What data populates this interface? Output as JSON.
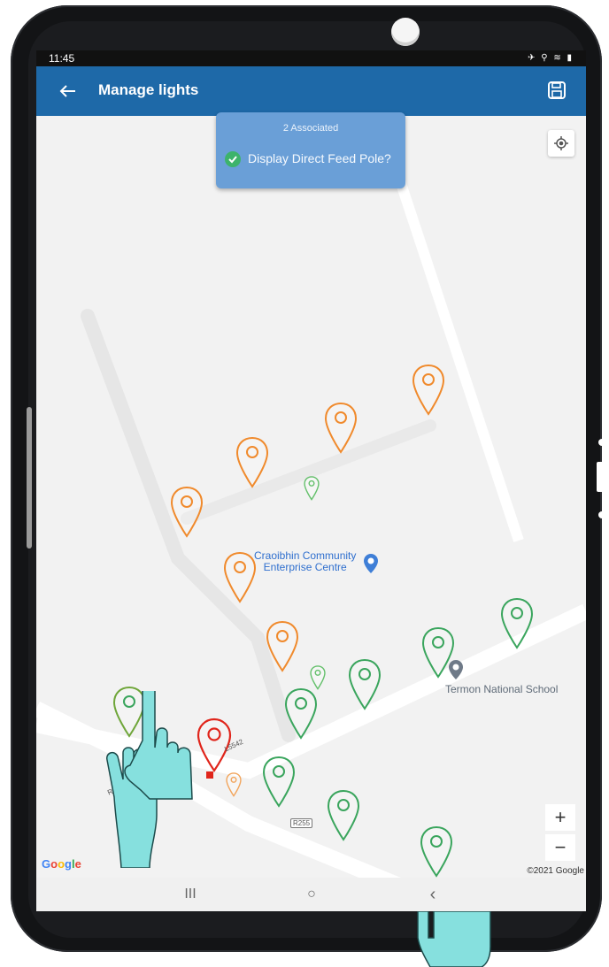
{
  "status_bar": {
    "time": "11:45",
    "icons": "✈ ⚲ ≋ ▮"
  },
  "app_bar": {
    "title": "Manage lights",
    "back_icon": "arrow-left-icon",
    "save_icon": "floppy-disk-icon"
  },
  "popup": {
    "count_label": "2 Associated",
    "option_label": "Display Direct Feed Pole?",
    "checked": true
  },
  "map": {
    "poi": [
      {
        "name": "Craoibhin Community Enterprise Centre",
        "lines": [
          "Craoibhin Community",
          "Enterprise Centre"
        ]
      },
      {
        "name": "Termon National School"
      }
    ],
    "road_labels": [
      "R255",
      "L5542",
      "R255"
    ],
    "zoom_in": "+",
    "zoom_out": "−",
    "attribution": "©2021 Google",
    "logo": "Google",
    "pin_colors": {
      "orange": "#f08a2c",
      "green": "#3aa55d",
      "red": "#e0251b",
      "light_green": "#64c06b"
    }
  },
  "nav_bar": {
    "recents": "III",
    "home": "○",
    "back": "‹"
  }
}
